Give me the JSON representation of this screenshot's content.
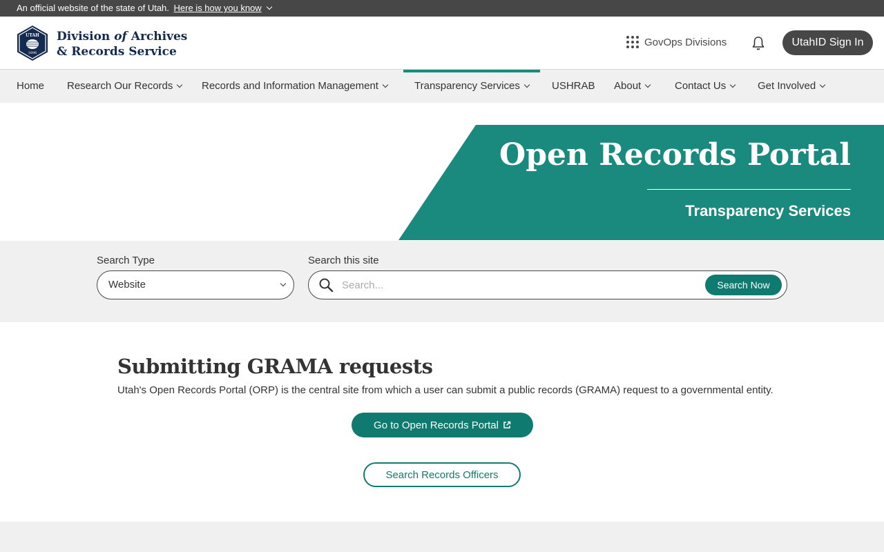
{
  "official_banner": {
    "text": "An official website of the state of Utah.",
    "link": "Here is how you know"
  },
  "header": {
    "brand_line1_a": "Division ",
    "brand_line1_b": "of",
    "brand_line1_c": " Archives",
    "brand_line2": "& Records Service",
    "seal_top": "UTAH",
    "seal_bottom": "1896",
    "govops_label": "GovOps Divisions",
    "signin_label": "UtahID Sign In"
  },
  "nav": {
    "items": [
      {
        "label": "Home"
      },
      {
        "label": "Research Our Records"
      },
      {
        "label": "Records and Information Management"
      },
      {
        "label": "Transparency Services"
      },
      {
        "label": "USHRAB"
      },
      {
        "label": "About"
      },
      {
        "label": "Contact Us"
      },
      {
        "label": "Get Involved"
      }
    ],
    "active": "Transparency Services"
  },
  "hero": {
    "title": "Open Records Portal",
    "subtitle": "Transparency Services",
    "band_color": "#1a8a7f"
  },
  "search": {
    "type_label": "Search Type",
    "type_value": "Website",
    "site_label": "Search this site",
    "placeholder": "Search...",
    "button_label": "Search Now"
  },
  "main": {
    "heading": "Submitting GRAMA requests",
    "description": "Utah's Open Records Portal (ORP) is the central site from which a user can submit a public records (GRAMA) request to a governmental entity.",
    "primary_button": "Go to Open Records Portal",
    "secondary_button": "Search Records Officers"
  },
  "colors": {
    "accent": "#0f7a70",
    "brand_navy": "#142a4f",
    "banner": "#474747"
  }
}
